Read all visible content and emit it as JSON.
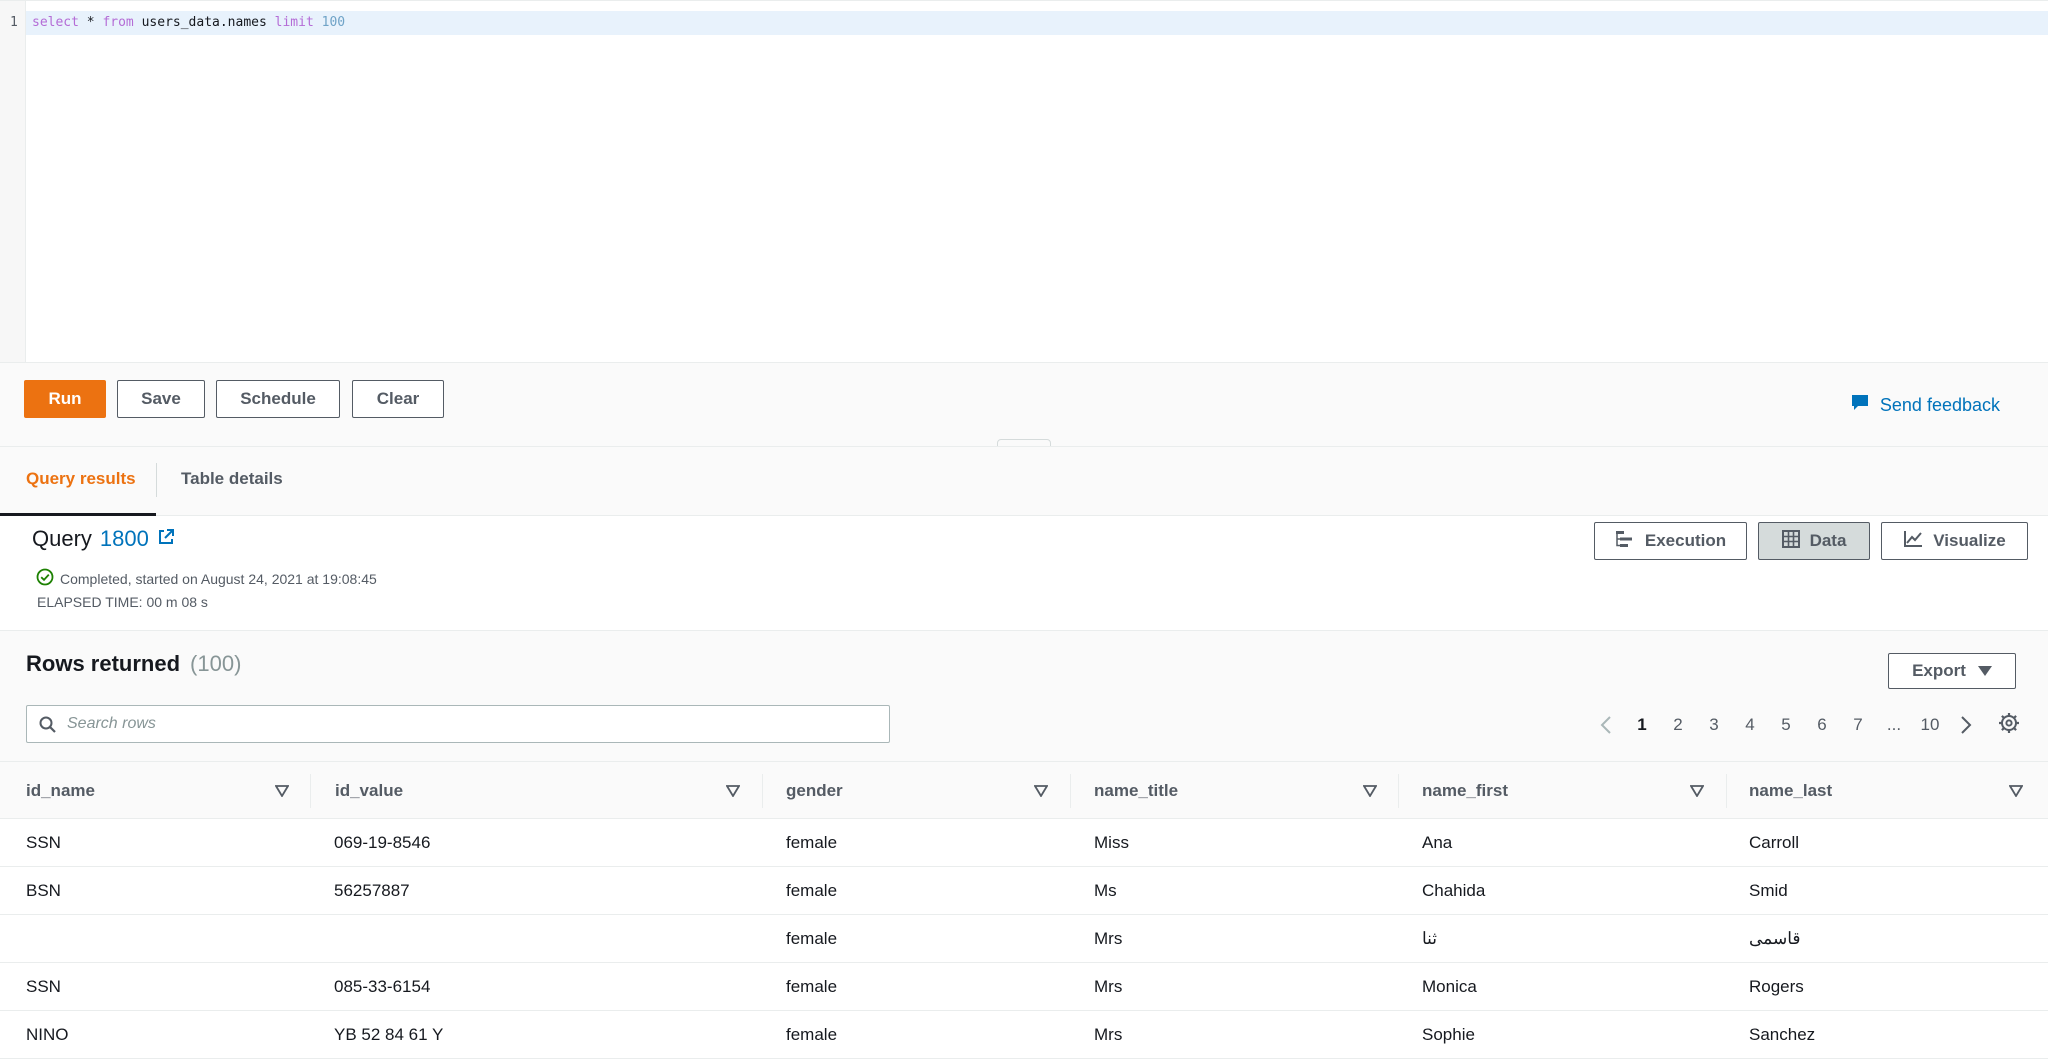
{
  "editor": {
    "line_number": "1",
    "code": {
      "kw_select": "select",
      "star": " * ",
      "kw_from": "from",
      "table": " users_data.names ",
      "kw_limit": "limit",
      "space": " ",
      "limit_value": "100"
    }
  },
  "toolbar": {
    "run_label": "Run",
    "save_label": "Save",
    "schedule_label": "Schedule",
    "clear_label": "Clear",
    "feedback_label": "Send feedback"
  },
  "tabs": {
    "query_results": "Query results",
    "table_details": "Table details"
  },
  "query": {
    "title_prefix": "Query",
    "id": "1800",
    "status": "Completed, started on August 24, 2021 at 19:08:45",
    "elapsed": "ELAPSED TIME: 00 m 08 s",
    "view_buttons": {
      "execution": "Execution",
      "data": "Data",
      "visualize": "Visualize"
    },
    "selected_view": "Data"
  },
  "results": {
    "title": "Rows returned",
    "count": "(100)",
    "export_label": "Export",
    "search_placeholder": "Search rows",
    "pagination": {
      "pages": [
        "1",
        "2",
        "3",
        "4",
        "5",
        "6",
        "7",
        "...",
        "10"
      ],
      "current": "1"
    },
    "columns": [
      "id_name",
      "id_value",
      "gender",
      "name_title",
      "name_first",
      "name_last"
    ],
    "rows": [
      [
        "SSN",
        "069-19-8546",
        "female",
        "Miss",
        "Ana",
        "Carroll"
      ],
      [
        "BSN",
        "56257887",
        "female",
        "Ms",
        "Chahida",
        "Smid"
      ],
      [
        "",
        "",
        "female",
        "Mrs",
        "ثنا",
        "قاسمی"
      ],
      [
        "SSN",
        "085-33-6154",
        "female",
        "Mrs",
        "Monica",
        "Rogers"
      ],
      [
        "NINO",
        "YB 52 84 61 Y",
        "female",
        "Mrs",
        "Sophie",
        "Sanchez"
      ]
    ]
  },
  "colors": {
    "accent": "#ec7211",
    "link": "#0073bb",
    "success": "#1d8102"
  }
}
